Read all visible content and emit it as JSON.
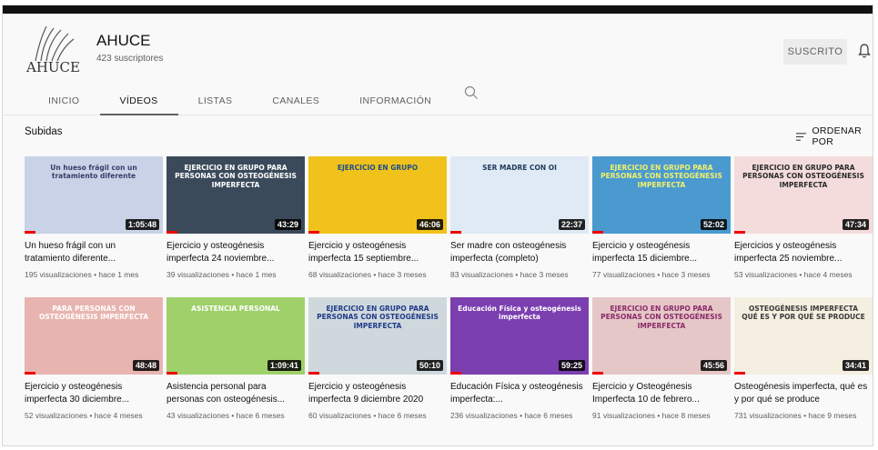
{
  "channel": {
    "name": "AHUCE",
    "logo_text": "AHUCE",
    "subscribers": "423 suscriptores",
    "subscribe_label": "SUSCRITO"
  },
  "tabs": [
    {
      "label": "INICIO"
    },
    {
      "label": "VÍDEOS"
    },
    {
      "label": "LISTAS"
    },
    {
      "label": "CANALES"
    },
    {
      "label": "INFORMACIÓN"
    }
  ],
  "section": {
    "title": "Subidas",
    "sort_label": "ORDENAR POR"
  },
  "videos": [
    {
      "title": "Un hueso frágil con un tratamiento diferente...",
      "meta": "195 visualizaciones • hace 1 mes",
      "duration": "1:05:48",
      "thumb_text": "Un hueso frágil con un tratamiento diferente",
      "bg": "#c9d2e6",
      "fg": "#3a3a6a"
    },
    {
      "title": "Ejercicio y osteogénesis imperfecta 24 noviembre...",
      "meta": "39 visualizaciones • hace 1 mes",
      "duration": "43:29",
      "thumb_text": "EJERCICIO EN GRUPO PARA PERSONAS CON OSTEOGÉNESIS IMPERFECTA",
      "bg": "#3b4a5a",
      "fg": "#ffffff"
    },
    {
      "title": "Ejercicio y osteogénesis imperfecta 15 septiembre...",
      "meta": "68 visualizaciones • hace 3 meses",
      "duration": "46:06",
      "thumb_text": "EJERCICIO EN GRUPO",
      "bg": "#f1c21b",
      "fg": "#1b4f8a"
    },
    {
      "title": "Ser madre con osteogénesis imperfecta (completo)",
      "meta": "83 visualizaciones • hace 3 meses",
      "duration": "22:37",
      "thumb_text": "SER MADRE CON OI",
      "bg": "#dfeaf5",
      "fg": "#1f3a5a"
    },
    {
      "title": "Ejercicio y osteogénesis imperfecta 15 diciembre...",
      "meta": "77 visualizaciones • hace 3 meses",
      "duration": "52:02",
      "thumb_text": "EJERCICIO EN GRUPO PARA PERSONAS CON OSTEOGÉNESIS IMPERFECTA",
      "bg": "#4a9ad0",
      "fg": "#f2f06a"
    },
    {
      "title": "Ejercicios y osteogénesis imperfecta 25 noviembre...",
      "meta": "53 visualizaciones • hace 4 meses",
      "duration": "47:34",
      "thumb_text": "EJERCICIO EN GRUPO PARA PERSONAS CON OSTEOGÉNESIS IMPERFECTA",
      "bg": "#f4dcdc",
      "fg": "#2a2a2a"
    },
    {
      "title": "Ejercicio y osteogénesis imperfecta 30 diciembre...",
      "meta": "52 visualizaciones • hace 4 meses",
      "duration": "48:48",
      "thumb_text": "PARA PERSONAS CON OSTEOGÉNESIS IMPERFECTA",
      "bg": "#e8b4b0",
      "fg": "#ffffff"
    },
    {
      "title": "Asistencia personal para personas con osteogénesis...",
      "meta": "43 visualizaciones • hace 6 meses",
      "duration": "1:09:41",
      "thumb_text": "ASISTENCIA PERSONAL",
      "bg": "#9fd06a",
      "fg": "#ffffff"
    },
    {
      "title": "Ejercicio y osteogénesis imperfecta 9 diciembre 2020",
      "meta": "60 visualizaciones • hace 6 meses",
      "duration": "50:10",
      "thumb_text": "EJERCICIO EN GRUPO PARA PERSONAS CON OSTEOGÉNESIS IMPERFECTA",
      "bg": "#cfd8dc",
      "fg": "#1f3a8a"
    },
    {
      "title": "Educación Física y osteogénesis imperfecta:...",
      "meta": "236 visualizaciones • hace 6 meses",
      "duration": "59:25",
      "thumb_text": "Educación Física y osteogénesis imperfecta",
      "bg": "#7b3fb0",
      "fg": "#ffffff"
    },
    {
      "title": "Ejercicio y Osteogénesis Imperfecta 10 de febrero...",
      "meta": "91 visualizaciones • hace 8 meses",
      "duration": "45:56",
      "thumb_text": "EJERCICIO EN GRUPO PARA PERSONAS CON OSTEOGÉNESIS IMPERFECTA",
      "bg": "#e6c7c7",
      "fg": "#8a2a6a"
    },
    {
      "title": "Osteogénesis imperfecta, qué es y por qué se produce",
      "meta": "731 visualizaciones • hace 9 meses",
      "duration": "34:41",
      "thumb_text": "OSTEOGÉNESIS IMPERFECTA QUÉ ES Y POR QUÉ SE PRODUCE",
      "bg": "#f4efe0",
      "fg": "#3a3a3a"
    }
  ],
  "colors": {
    "accent": "#ee0000",
    "text": "#0f0f0f",
    "secondary": "#606060"
  },
  "icons": {
    "search": "search-icon",
    "bell": "bell-icon",
    "sort": "sort-icon"
  }
}
